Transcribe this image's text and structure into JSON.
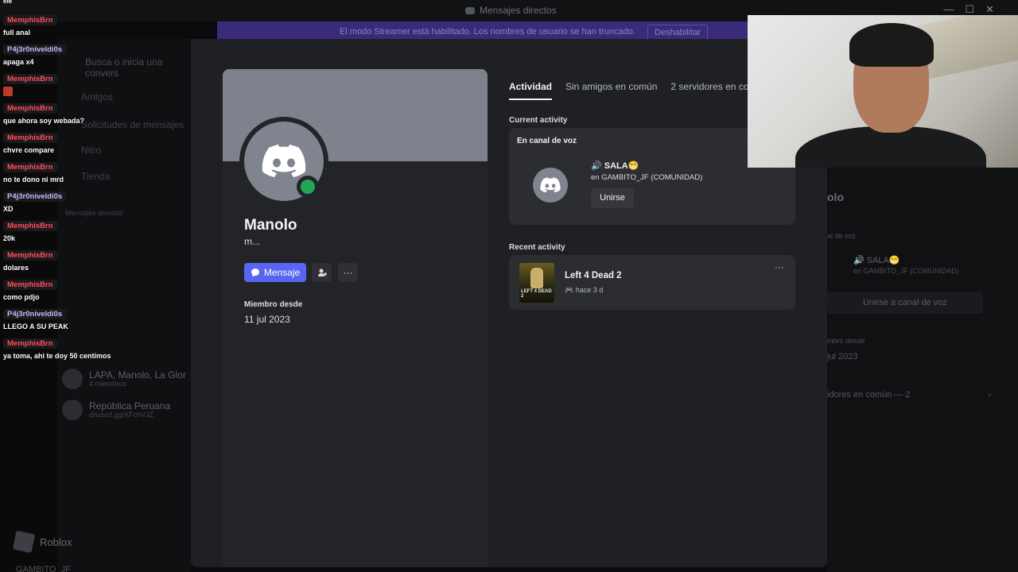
{
  "window": {
    "title": "Mensajes directos",
    "controls": [
      "—",
      "☐",
      "✕"
    ]
  },
  "streamer_banner": {
    "text": "El modo Streamer está habilitado. Los nombres de usuario se han truncado.",
    "button": "Deshabilitar"
  },
  "bg_sidebar": {
    "search": "Busca o inicia una convers",
    "items": [
      "Amigos",
      "Solicitudes de mensajes",
      "Nitro",
      "Tienda",
      "Mensajes directos"
    ],
    "dms": [
      {
        "name": "LAPA, Manolo, La Glor",
        "sub": "4 miembros"
      },
      {
        "name": "República Peruana",
        "sub": "discord.gg/XFchVJZ"
      }
    ],
    "roblox": "Roblox",
    "bottom_user": "GAMBITO_JF"
  },
  "bg_right": {
    "name": "olo",
    "voice_label": "al de voz",
    "sala": "🔊 SALA😁",
    "server": "en GAMBITO_JF (COMUNIDAD)",
    "join": "Unirse a canal de voz",
    "member_label": "mbro desde",
    "member_date": "jul 2023",
    "servers": "idores en común — 2"
  },
  "profile": {
    "name": "Manolo",
    "username": "m...",
    "message_button": "Mensaje",
    "member_since_label": "Miembro desde",
    "member_since": "11 jul 2023",
    "status_color": "#23a55a",
    "accent_color": "#5865f2"
  },
  "tabs": [
    {
      "label": "Actividad",
      "active": true
    },
    {
      "label": "Sin amigos en común",
      "active": false
    },
    {
      "label": "2 servidores en comú",
      "active": false
    }
  ],
  "activity": {
    "current_label": "Current activity",
    "voice_header": "En canal de voz",
    "channel": "🔊 SALA😁",
    "server": "en GAMBITO_JF (COMUNIDAD)",
    "join_button": "Unirse",
    "recent_label": "Recent activity",
    "game_name": "Left 4 Dead 2",
    "game_time": "🎮 hace 3 d",
    "game_cover_text": "LEFT 4 DEAD 2"
  },
  "chat": {
    "top_fragment": "ele",
    "messages": [
      {
        "user": "MemphisBrn",
        "text": "full anal",
        "color": "red"
      },
      {
        "user": "P4j3r0niveldi0s",
        "text": "apaga x4",
        "color": "purple"
      },
      {
        "user": "MemphisBrn",
        "text": "",
        "color": "red",
        "emote": true
      },
      {
        "user": "MemphisBrn",
        "text": "que ahora soy webada?",
        "color": "red"
      },
      {
        "user": "MemphisBrn",
        "text": "chvre compare",
        "color": "red"
      },
      {
        "user": "MemphisBrn",
        "text": "no te dono ni mrd",
        "color": "red"
      },
      {
        "user": "P4j3r0niveldi0s",
        "text": "XD",
        "color": "purple"
      },
      {
        "user": "MemphisBrn",
        "text": "20k",
        "color": "red"
      },
      {
        "user": "MemphisBrn",
        "text": "dolares",
        "color": "red"
      },
      {
        "user": "MemphisBrn",
        "text": "como pdjo",
        "color": "red"
      },
      {
        "user": "P4j3r0niveldi0s",
        "text": "LLEGO A SU PEAK",
        "color": "purple"
      },
      {
        "user": "MemphisBrn",
        "text": "ya toma, ahi te doy 50 centimos",
        "color": "red"
      }
    ]
  }
}
